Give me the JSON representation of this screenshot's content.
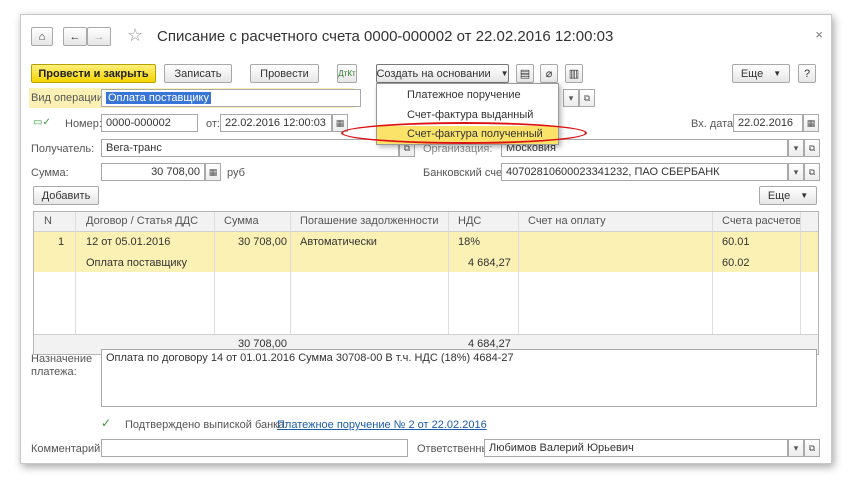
{
  "window": {
    "title": "Списание с расчетного счета 0000-000002 от 22.02.2016 12:00:03",
    "close": "×"
  },
  "toolbar": {
    "post_close": "Провести и закрыть",
    "save": "Записать",
    "post": "Провести",
    "create_based": "Создать на основании",
    "more": "Еще",
    "help": "?"
  },
  "dropdown": {
    "items": [
      "Платежное поручение",
      "Счет-фактура выданный",
      "Счет-фактура полученный"
    ]
  },
  "form": {
    "op_type_label": "Вид операции:",
    "op_type_value": "Оплата поставщику",
    "number_label": "Номер:",
    "number_value": "0000-000002",
    "date_label": "от:",
    "date_value": "22.02.2016 12:00:03",
    "in_date_label": "Вх. дата:",
    "in_date_value": "22.02.2016",
    "recipient_label": "Получатель:",
    "recipient_value": "Вега-транс",
    "org_label": "Организация:",
    "org_value": "Московия",
    "sum_label": "Сумма:",
    "sum_value": "30 708,00",
    "currency": "руб",
    "bank_label": "Банковский счет:",
    "bank_value": "40702810600023341232, ПАО СБЕРБАНК"
  },
  "table_toolbar": {
    "add": "Добавить",
    "more": "Еще"
  },
  "table": {
    "headers": [
      "N",
      "Договор / Статья ДДС",
      "Сумма",
      "Погашение задолженности",
      "НДС",
      "Счет на оплату",
      "Счета расчетов"
    ],
    "row": {
      "n": "1",
      "contract": "12 от 05.01.2016",
      "article": "Оплата поставщику",
      "sum": "30 708,00",
      "repay": "Автоматически",
      "vat_rate": "18%",
      "vat_sum": "4 684,27",
      "acc1": "60.01",
      "acc2": "60.02"
    },
    "footer": {
      "sum": "30 708,00",
      "vat": "4 684,27"
    }
  },
  "purpose": {
    "label": "Назначение платежа:",
    "value": "Оплата по договору 14 от 01.01.2016 Сумма 30708-00 В т.ч. НДС  (18%) 4684-27"
  },
  "confirm": {
    "label": "Подтверждено выпиской банка:",
    "link": "Платежное поручение № 2 от 22.02.2016"
  },
  "bottom": {
    "comment_label": "Комментарий:",
    "comment_value": "",
    "responsible_label": "Ответственный:",
    "responsible_value": "Любимов Валерий Юрьевич"
  },
  "colors": {
    "accent_yellow": "#f5d400",
    "row_highlight": "#fbf1b5",
    "annotation_red": "#dd1111",
    "link_blue": "#1c5ca8"
  }
}
